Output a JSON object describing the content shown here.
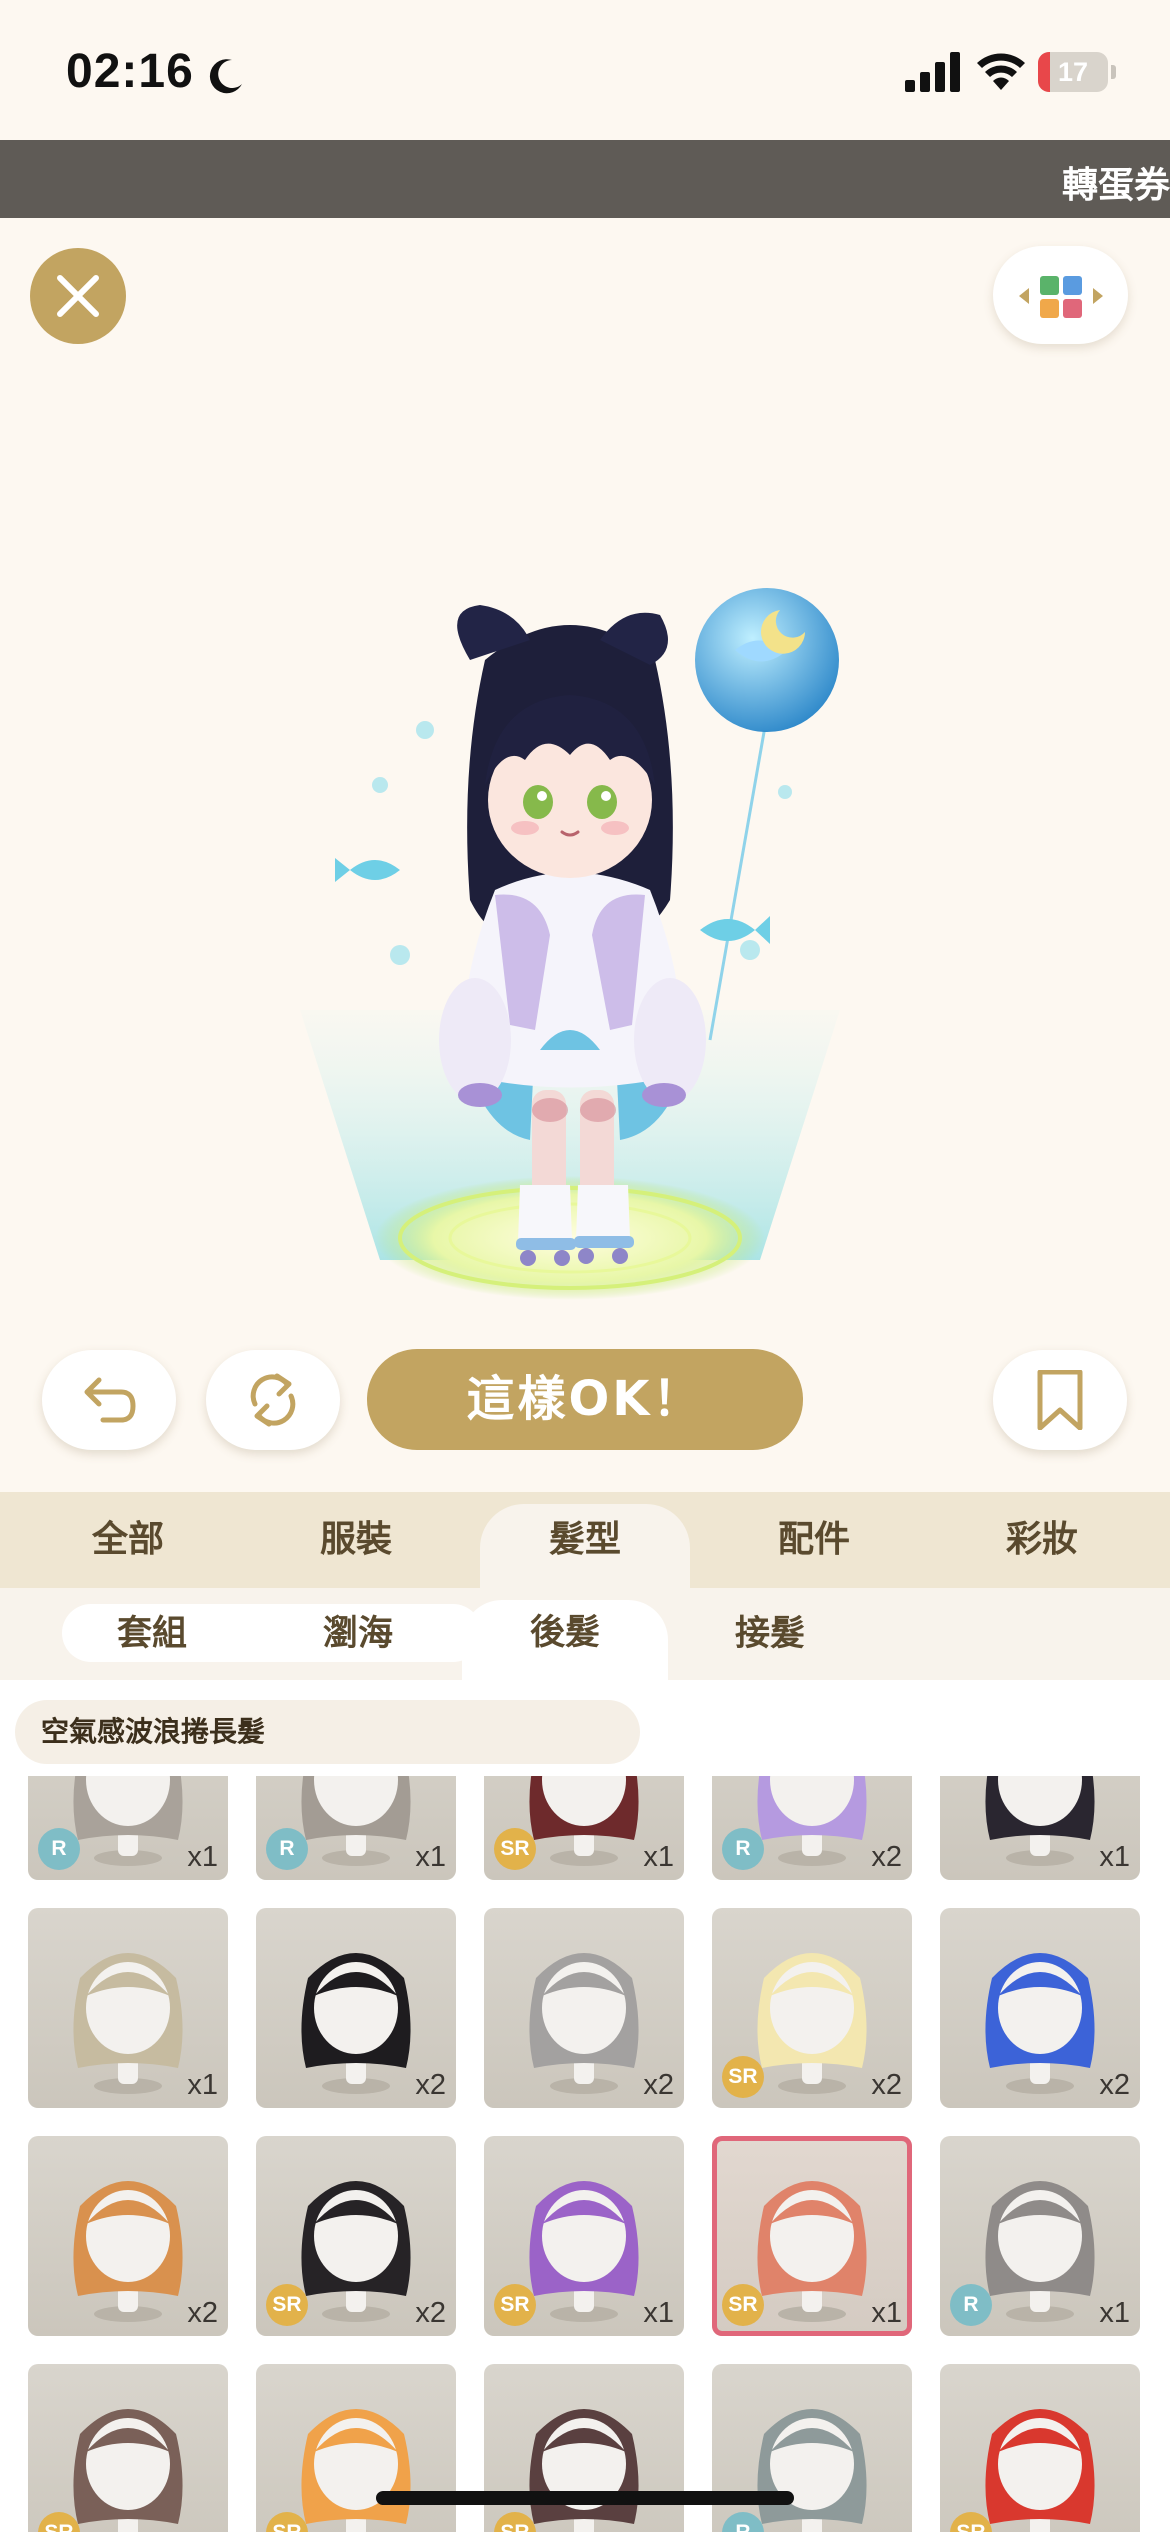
{
  "status": {
    "time": "02:16",
    "battery": "17",
    "battery_level": 0.17
  },
  "ticker": {
    "text": "轉蛋券"
  },
  "preview": {
    "ok_label": "這樣OK！"
  },
  "categories": [
    {
      "label": "全部"
    },
    {
      "label": "服裝"
    },
    {
      "label": "髮型",
      "active": true
    },
    {
      "label": "配件"
    },
    {
      "label": "彩妝"
    }
  ],
  "subcategories": [
    {
      "label": "套組"
    },
    {
      "label": "瀏海"
    },
    {
      "label": "後髮",
      "active": true
    },
    {
      "label": "接髮"
    }
  ],
  "selected_item_name": "空氣感波浪捲長髮",
  "items": [
    {
      "rarity": "R",
      "count": "x1",
      "hair_color": "#a9a29a"
    },
    {
      "rarity": "R",
      "count": "x1",
      "hair_color": "#a39c94"
    },
    {
      "rarity": "SR",
      "count": "x1",
      "hair_color": "#6e2a2c"
    },
    {
      "rarity": "R",
      "count": "x2",
      "hair_color": "#b59ae0"
    },
    {
      "rarity": "",
      "count": "x1",
      "hair_color": "#2a2630"
    },
    {
      "rarity": "",
      "count": "x1",
      "hair_color": "#c6bba0"
    },
    {
      "rarity": "",
      "count": "x2",
      "hair_color": "#1e1c1f"
    },
    {
      "rarity": "",
      "count": "x2",
      "hair_color": "#a3a1a0"
    },
    {
      "rarity": "SR",
      "count": "x2",
      "hair_color": "#f3e7b0"
    },
    {
      "rarity": "",
      "count": "x2",
      "hair_color": "#3c63d8"
    },
    {
      "rarity": "",
      "count": "x2",
      "hair_color": "#d9914e"
    },
    {
      "rarity": "SR",
      "count": "x2",
      "hair_color": "#262326"
    },
    {
      "rarity": "SR",
      "count": "x1",
      "hair_color": "#9b63c8"
    },
    {
      "rarity": "SR",
      "count": "x1",
      "hair_color": "#e0836a",
      "selected": true
    },
    {
      "rarity": "R",
      "count": "x1",
      "hair_color": "#8f8b89"
    },
    {
      "rarity": "SR",
      "count": "",
      "hair_color": "#7a6058"
    },
    {
      "rarity": "SR",
      "count": "",
      "hair_color": "#f0a24a"
    },
    {
      "rarity": "SR",
      "count": "",
      "hair_color": "#5a4040"
    },
    {
      "rarity": "R",
      "count": "",
      "hair_color": "#8e9a9a"
    },
    {
      "rarity": "SR",
      "count": "",
      "hair_color": "#d9382e"
    }
  ],
  "colors": {
    "gold": "#c2a461",
    "selected_border": "#e0677a",
    "ticker_bg": "#5f5b56"
  }
}
